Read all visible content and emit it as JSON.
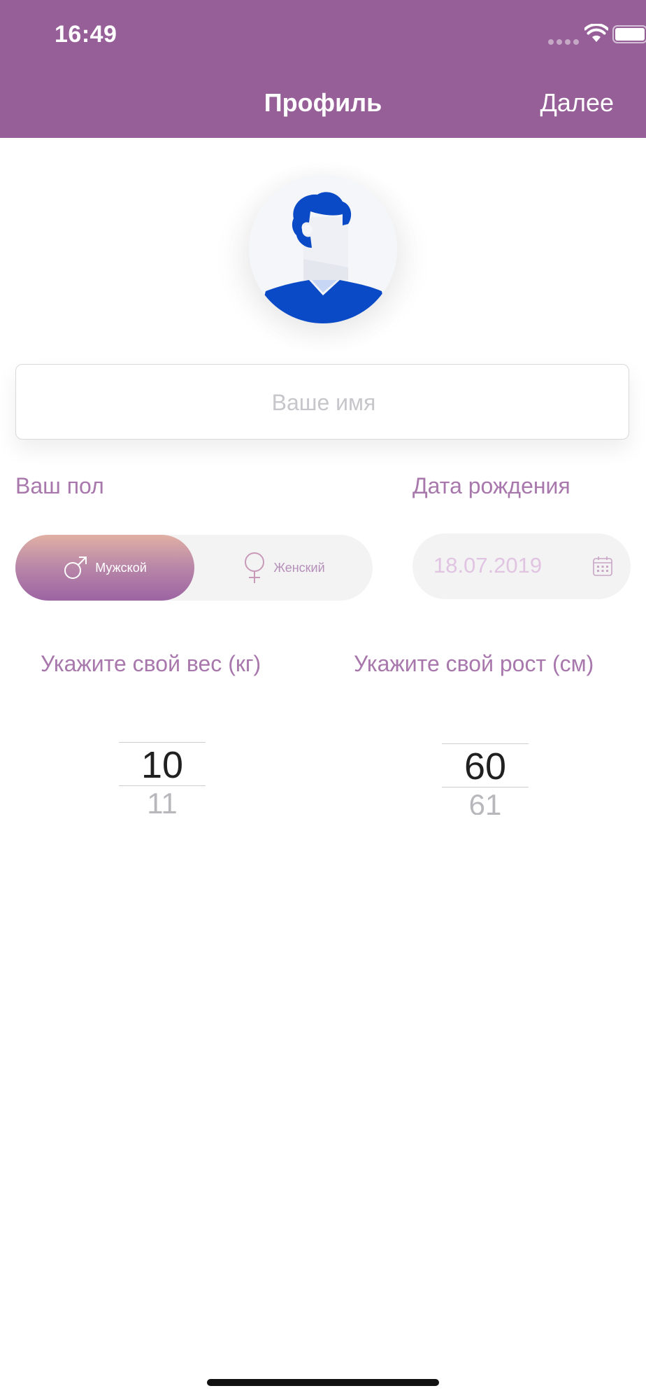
{
  "status_bar": {
    "time": "16:49"
  },
  "nav": {
    "title": "Профиль",
    "next_label": "Далее"
  },
  "avatar": {
    "icon": "male-avatar-icon"
  },
  "name_field": {
    "placeholder": "Ваше имя",
    "value": ""
  },
  "gender": {
    "label": "Ваш пол",
    "selected": "male",
    "options": [
      {
        "id": "male",
        "label": "Мужской",
        "icon": "male-symbol-icon"
      },
      {
        "id": "female",
        "label": "Женский",
        "icon": "female-symbol-icon"
      }
    ]
  },
  "birthdate": {
    "label": "Дата рождения",
    "value": "18.07.2019",
    "icon": "calendar-icon"
  },
  "weight": {
    "label": "Укажите свой вес (кг)",
    "selected": "10",
    "next": "11"
  },
  "height": {
    "label": "Укажите свой рост (см)",
    "selected": "60",
    "next": "61"
  },
  "colors": {
    "header": "#965f98",
    "label_text": "#a878ad",
    "gradient_top": "#e0b0a4",
    "gradient_bottom": "#9c64a2",
    "avatar_blue": "#0a4ac6"
  }
}
